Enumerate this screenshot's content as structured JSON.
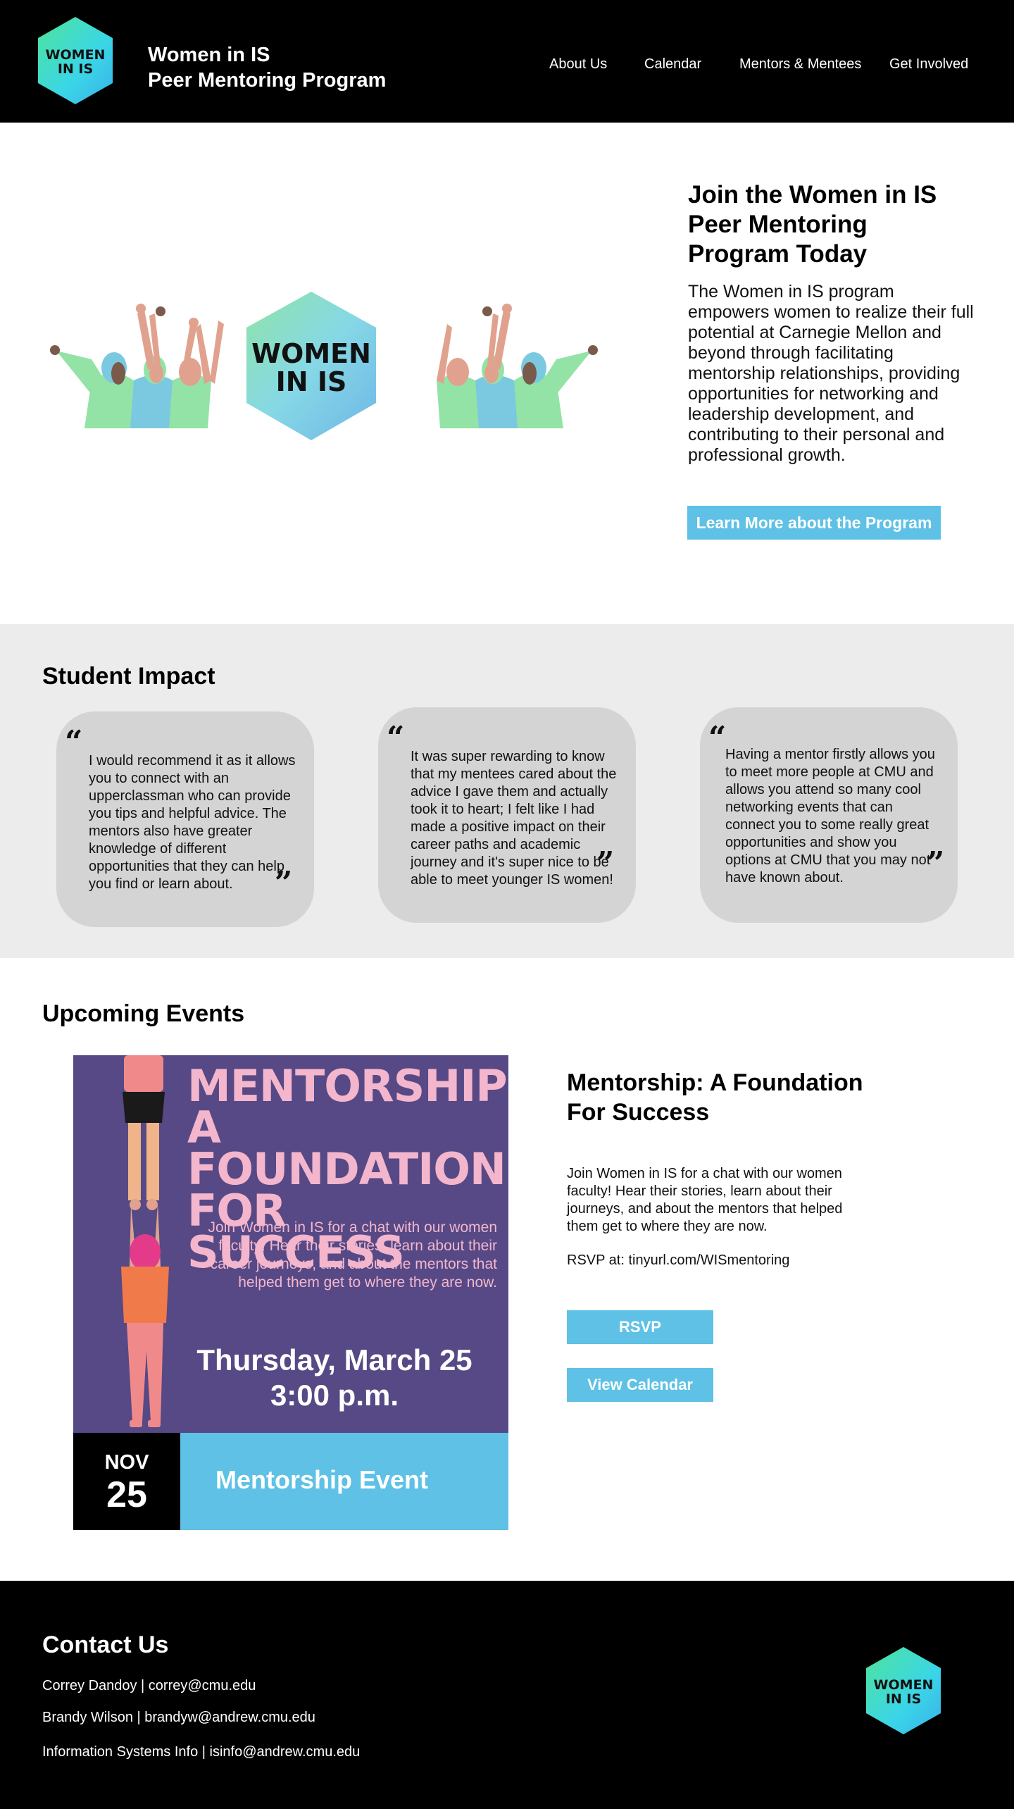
{
  "header": {
    "logo_text_line1": "WOMEN",
    "logo_text_line2": "IN IS",
    "brand_line1": "Women in IS",
    "brand_line2": "Peer Mentoring Program",
    "nav": [
      "About Us",
      "Calendar",
      "Mentors & Mentees",
      "Get Involved"
    ]
  },
  "hero": {
    "art_text_line1": "WOMEN",
    "art_text_line2": "IN IS",
    "title": "Join the Women in IS Peer Mentoring Program Today",
    "body": "The Women in IS program empowers women to realize their full potential at Carnegie Mellon and beyond through facilitating mentorship relationships, providing opportunities for networking and leadership development, and contributing to their personal and professional growth.",
    "button": "Learn More about the Program"
  },
  "impact": {
    "title": "Student Impact",
    "quotes": [
      "I would recommend it as it allows you to connect with an upperclassman who can provide you tips and helpful advice. The mentors also have greater knowledge of different opportunities that they can help you find or learn about.",
      "It was super rewarding to know that my mentees cared about the advice I gave them and actually took it to heart; I felt like I had made a positive impact on their career paths and academic journey and it's super nice to be able to meet younger IS women!",
      "Having a mentor firstly allows you to meet more people at CMU and allows you attend so many cool networking events that can connect you to some really great opportunities and show you options at CMU that you may not have known about."
    ]
  },
  "events": {
    "title": "Upcoming Events",
    "poster": {
      "title": "MENTORSHIP: A FOUNDATION FOR SUCCESS",
      "body": "Join Women in IS for a chat with our women faculty! Hear their stories, learn about their career journeys, and about the mentors that helped them get to where they are now.",
      "date_line1": "Thursday, March 25",
      "date_line2": "3:00 p.m."
    },
    "date_month": "NOV",
    "date_day": "25",
    "strip_label": "Mentorship Event",
    "event_title": "Mentorship: A Foundation For Success",
    "event_desc": "Join Women in IS for a chat with our women faculty! Hear their stories, learn about their journeys, and about the mentors that helped them get to where they are now.",
    "rsvp_text": "RSVP at: tinyurl.com/WISmentoring",
    "rsvp_button": "RSVP",
    "calendar_button": "View Calendar"
  },
  "footer": {
    "title": "Contact Us",
    "lines": [
      "Correy Dandoy | correy@cmu.edu",
      "Brandy Wilson | brandyw@andrew.cmu.edu",
      "Information Systems Info | isinfo@andrew.cmu.edu"
    ],
    "logo_text_line1": "WOMEN",
    "logo_text_line2": "IN IS"
  },
  "colors": {
    "accent_blue": "#5ec1e5",
    "poster_purple": "#564985",
    "poster_pink": "#f3b6cc",
    "logo_green": "#4fe0a0",
    "logo_cyan": "#3ad6e8",
    "impact_bg": "#ececec",
    "card_bg": "#d4d4d4"
  }
}
